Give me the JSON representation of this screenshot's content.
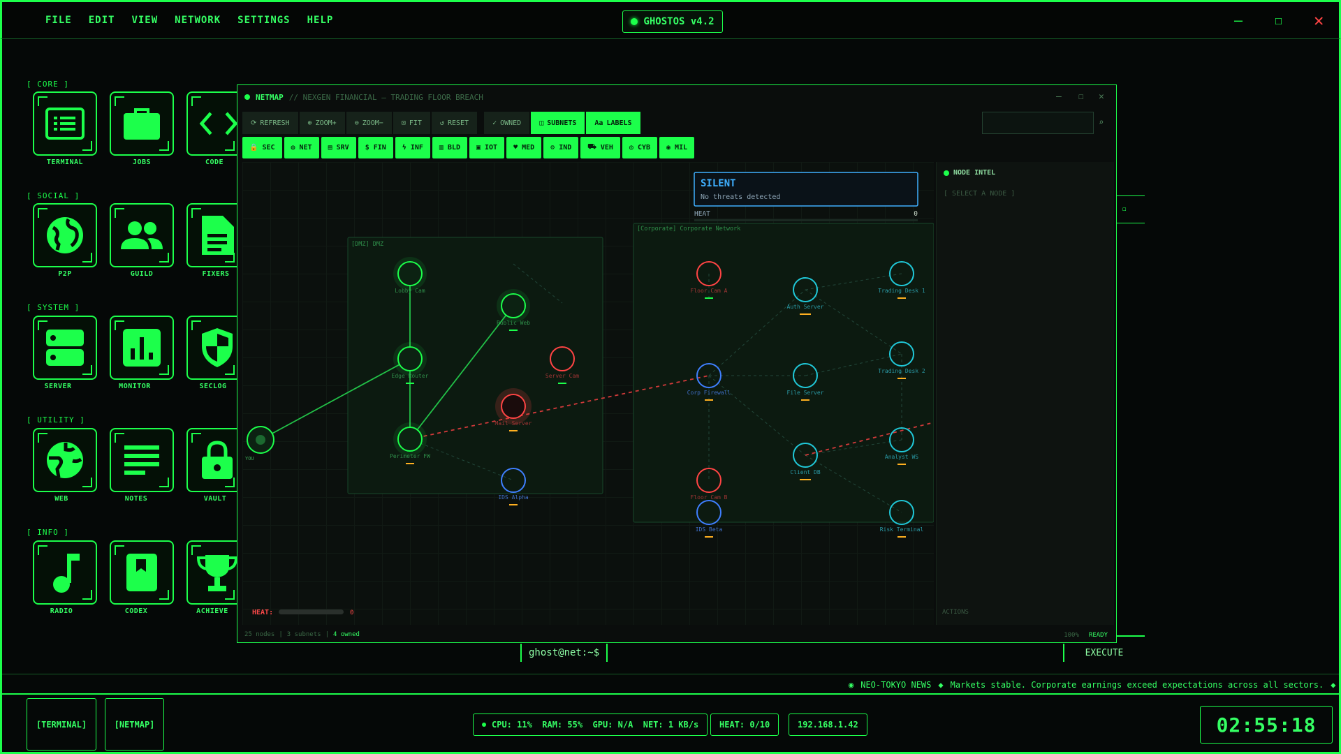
{
  "menu": [
    "FILE",
    "EDIT",
    "VIEW",
    "NETWORK",
    "SETTINGS",
    "HELP"
  ],
  "os_badge": "GHOSTOS v4.2",
  "colors": {
    "accent": "#1cff4b",
    "danger": "#ff4444",
    "node_blue": "#3f7fff",
    "node_cyan": "#20c8d8",
    "warn": "#ffb020"
  },
  "desktop": {
    "categories": [
      {
        "label": "[ CORE ]",
        "icons": [
          {
            "name": "terminal",
            "label": "TERMINAL",
            "icon": "terminal-icon"
          },
          {
            "name": "jobs",
            "label": "JOBS",
            "icon": "briefcase-icon"
          },
          {
            "name": "code",
            "label": "CODE",
            "icon": "code-icon"
          }
        ]
      },
      {
        "label": "[ SOCIAL ]",
        "icons": [
          {
            "name": "p2p",
            "label": "P2P",
            "icon": "globe-icon"
          },
          {
            "name": "guild",
            "label": "GUILD",
            "icon": "people-icon"
          },
          {
            "name": "fixers",
            "label": "FIXERS",
            "icon": "document-icon"
          }
        ]
      },
      {
        "label": "[ SYSTEM ]",
        "icons": [
          {
            "name": "server",
            "label": "SERVER",
            "icon": "server-icon"
          },
          {
            "name": "monitor",
            "label": "MONITOR",
            "icon": "bar-chart-icon"
          },
          {
            "name": "seclog",
            "label": "SECLOG",
            "icon": "shield-icon"
          }
        ]
      },
      {
        "label": "[ UTILITY ]",
        "icons": [
          {
            "name": "web",
            "label": "WEB",
            "icon": "web-globe-icon"
          },
          {
            "name": "notes",
            "label": "NOTES",
            "icon": "notes-icon"
          },
          {
            "name": "vault",
            "label": "VAULT",
            "icon": "lock-icon"
          }
        ]
      },
      {
        "label": "[ INFO ]",
        "icons": [
          {
            "name": "radio",
            "label": "RADIO",
            "icon": "music-note-icon"
          },
          {
            "name": "codex",
            "label": "CODEX",
            "icon": "book-icon"
          },
          {
            "name": "achieve",
            "label": "ACHIEVE",
            "icon": "trophy-icon"
          }
        ]
      }
    ]
  },
  "netmap": {
    "title": "NETMAP",
    "subtitle": "// NEXGEN FINANCIAL — TRADING FLOOR BREACH",
    "toolbar": [
      {
        "key": "refresh",
        "label": "REFRESH",
        "glyph": "⟳",
        "on": false
      },
      {
        "key": "zoom-in",
        "label": "ZOOM+",
        "glyph": "⊕",
        "on": false
      },
      {
        "key": "zoom-out",
        "label": "ZOOM−",
        "glyph": "⊖",
        "on": false
      },
      {
        "key": "fit",
        "label": "FIT",
        "glyph": "⊡",
        "on": false
      },
      {
        "key": "reset",
        "label": "RESET",
        "glyph": "↺",
        "on": false
      },
      {
        "key": "owned",
        "label": "OWNED",
        "glyph": "✓",
        "on": false
      },
      {
        "key": "subnets",
        "label": "SUBNETS",
        "glyph": "◫",
        "on": true
      },
      {
        "key": "labels",
        "label": "LABELS",
        "glyph": "Aa",
        "on": true
      }
    ],
    "filters": [
      {
        "key": "sec",
        "label": "SEC",
        "glyph": "🔒"
      },
      {
        "key": "net",
        "label": "NET",
        "glyph": "◍"
      },
      {
        "key": "srv",
        "label": "SRV",
        "glyph": "▤"
      },
      {
        "key": "fin",
        "label": "FIN",
        "glyph": "$"
      },
      {
        "key": "inf",
        "label": "INF",
        "glyph": "ϟ"
      },
      {
        "key": "bld",
        "label": "BLD",
        "glyph": "▥"
      },
      {
        "key": "iot",
        "label": "IOT",
        "glyph": "▣"
      },
      {
        "key": "med",
        "label": "MED",
        "glyph": "♥"
      },
      {
        "key": "ind",
        "label": "IND",
        "glyph": "⚙"
      },
      {
        "key": "veh",
        "label": "VEH",
        "glyph": "⛟"
      },
      {
        "key": "cyb",
        "label": "CYB",
        "glyph": "◎"
      },
      {
        "key": "mil",
        "label": "MIL",
        "glyph": "◉"
      }
    ],
    "alert": {
      "status": "SILENT",
      "detail": "No threats detected",
      "heat_label": "HEAT",
      "heat_value": "0"
    },
    "subnets": [
      {
        "label": "[DMZ] DMZ"
      },
      {
        "label": "[Corporate] Corporate Network"
      }
    ],
    "you_label": "YOU",
    "nodes": [
      {
        "label": "Lobby Cam",
        "state": "owned"
      },
      {
        "label": "Public Web",
        "state": "owned"
      },
      {
        "label": "Edge Router",
        "state": "owned"
      },
      {
        "label": "Server Cam",
        "state": "hostile"
      },
      {
        "label": "Mail Server",
        "state": "hostile"
      },
      {
        "label": "Perimeter FW",
        "state": "owned"
      },
      {
        "label": "IDS Alpha",
        "state": "security"
      },
      {
        "label": "Floor Cam A",
        "state": "hostile"
      },
      {
        "label": "Auth Server",
        "state": "neutral"
      },
      {
        "label": "Trading Desk 1",
        "state": "neutral"
      },
      {
        "label": "Corp Firewall",
        "state": "security"
      },
      {
        "label": "File Server",
        "state": "neutral"
      },
      {
        "label": "Trading Desk 2",
        "state": "neutral"
      },
      {
        "label": "Client DB",
        "state": "neutral"
      },
      {
        "label": "Analyst WS",
        "state": "neutral"
      },
      {
        "label": "Floor Cam B",
        "state": "hostile"
      },
      {
        "label": "IDS Beta",
        "state": "security"
      },
      {
        "label": "Risk Terminal",
        "state": "neutral"
      }
    ],
    "heat": {
      "label": "HEAT:",
      "value": "0",
      "level": 0
    },
    "intel": {
      "title": "NODE INTEL",
      "hint": "[ SELECT A NODE ]",
      "actions": "ACTIONS"
    },
    "status": {
      "nodes": "25 nodes",
      "subnets": "3 subnets",
      "owned": "4 owned",
      "zoom": "100%",
      "state": "READY"
    }
  },
  "terminal": {
    "prompt": "ghost@net:~$",
    "execute": "EXECUTE"
  },
  "news": {
    "source": "NEO-TOKYO NEWS",
    "headline": "Markets stable. Corporate earnings exceed expectations across all sectors."
  },
  "taskbar": {
    "apps": [
      "[TERMINAL]",
      "[NETMAP]"
    ],
    "sys": "CPU: 11%  RAM: 55%  GPU: N/A  NET: 1 KB/s",
    "heat": "HEAT: 0/10",
    "ip": "192.168.1.42",
    "clock": "02:55:18"
  }
}
